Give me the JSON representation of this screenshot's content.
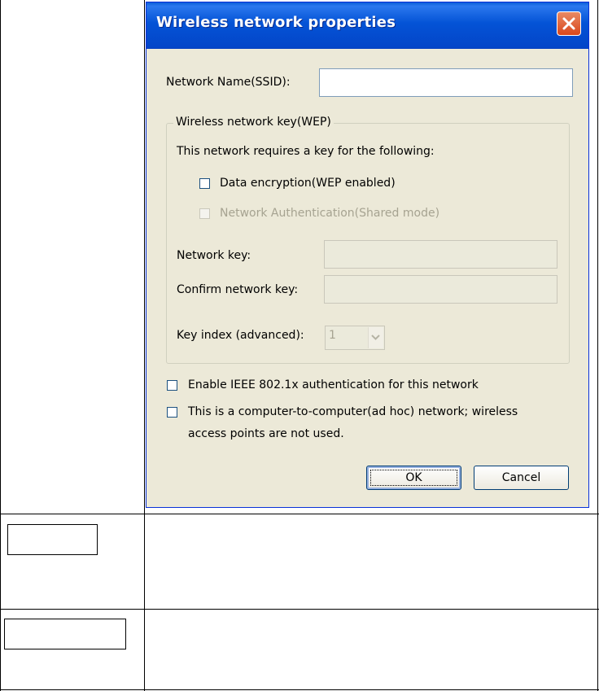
{
  "dialog": {
    "title": "Wireless network properties",
    "ssid_label": "Network Name(SSID):",
    "ssid_value": "",
    "wep_group": {
      "legend": "Wireless network key(WEP)",
      "description": "This network requires a key for the following:",
      "data_encryption_label": "Data encryption(WEP enabled)",
      "data_encryption_checked": false,
      "network_auth_label": "Network Authentication(Shared mode)",
      "network_auth_checked": false,
      "network_key_label": "Network key:",
      "network_key_value": "",
      "confirm_key_label": "Confirm network key:",
      "confirm_key_value": "",
      "key_index_label": "Key index (advanced):",
      "key_index_value": "1"
    },
    "ieee_label": "Enable IEEE 802.1x authentication for this network",
    "ieee_checked": false,
    "adhoc_label_line1": "This is a computer-to-computer(ad hoc) network; wireless",
    "adhoc_label_line2": "access points are not used.",
    "adhoc_checked": false,
    "ok_label": "OK",
    "cancel_label": "Cancel"
  },
  "colors": {
    "titlebar": "#0453d6",
    "dialog_bg": "#ece9d8",
    "close_button": "#d9471c"
  },
  "icons": [
    "close-icon",
    "chevron-down-icon"
  ]
}
